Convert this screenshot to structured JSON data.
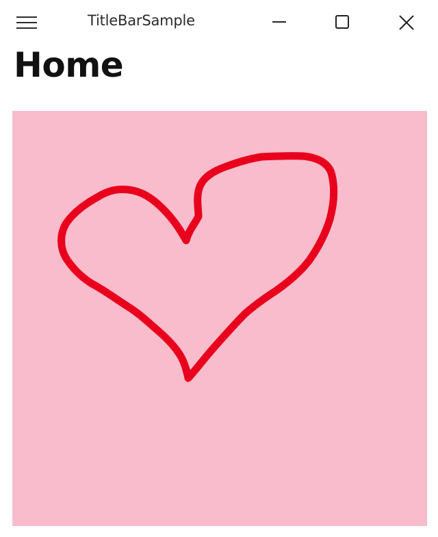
{
  "titlebar": {
    "app_title": "TitleBarSample"
  },
  "page": {
    "title": "Home"
  },
  "canvas": {
    "background_color": "#f8bccc",
    "ink_color": "#e8001c"
  }
}
